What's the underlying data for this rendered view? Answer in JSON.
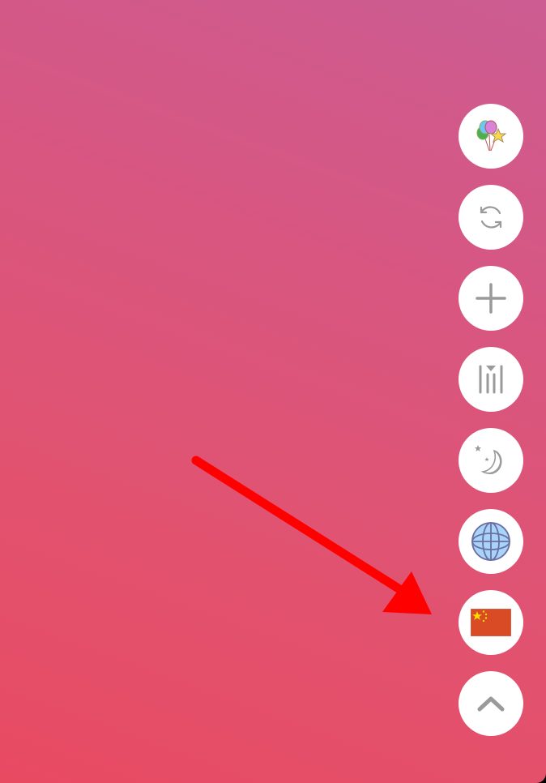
{
  "colors": {
    "arrow": "#ff0000",
    "icon_gray": "#9a9a9a",
    "button_bg": "#ffffff",
    "background_top": "#cc5c92",
    "background_bottom": "#e84a62"
  },
  "toolbar": {
    "buttons": [
      {
        "icon": "balloons-icon"
      },
      {
        "icon": "refresh-icon"
      },
      {
        "icon": "plus-icon"
      },
      {
        "icon": "bookmark-bars-icon"
      },
      {
        "icon": "moon-icon"
      },
      {
        "icon": "globe-icon"
      },
      {
        "icon": "china-flag-icon"
      },
      {
        "icon": "chevron-up-icon"
      }
    ]
  },
  "annotation": {
    "type": "arrow",
    "points_to": "china-flag-icon"
  }
}
